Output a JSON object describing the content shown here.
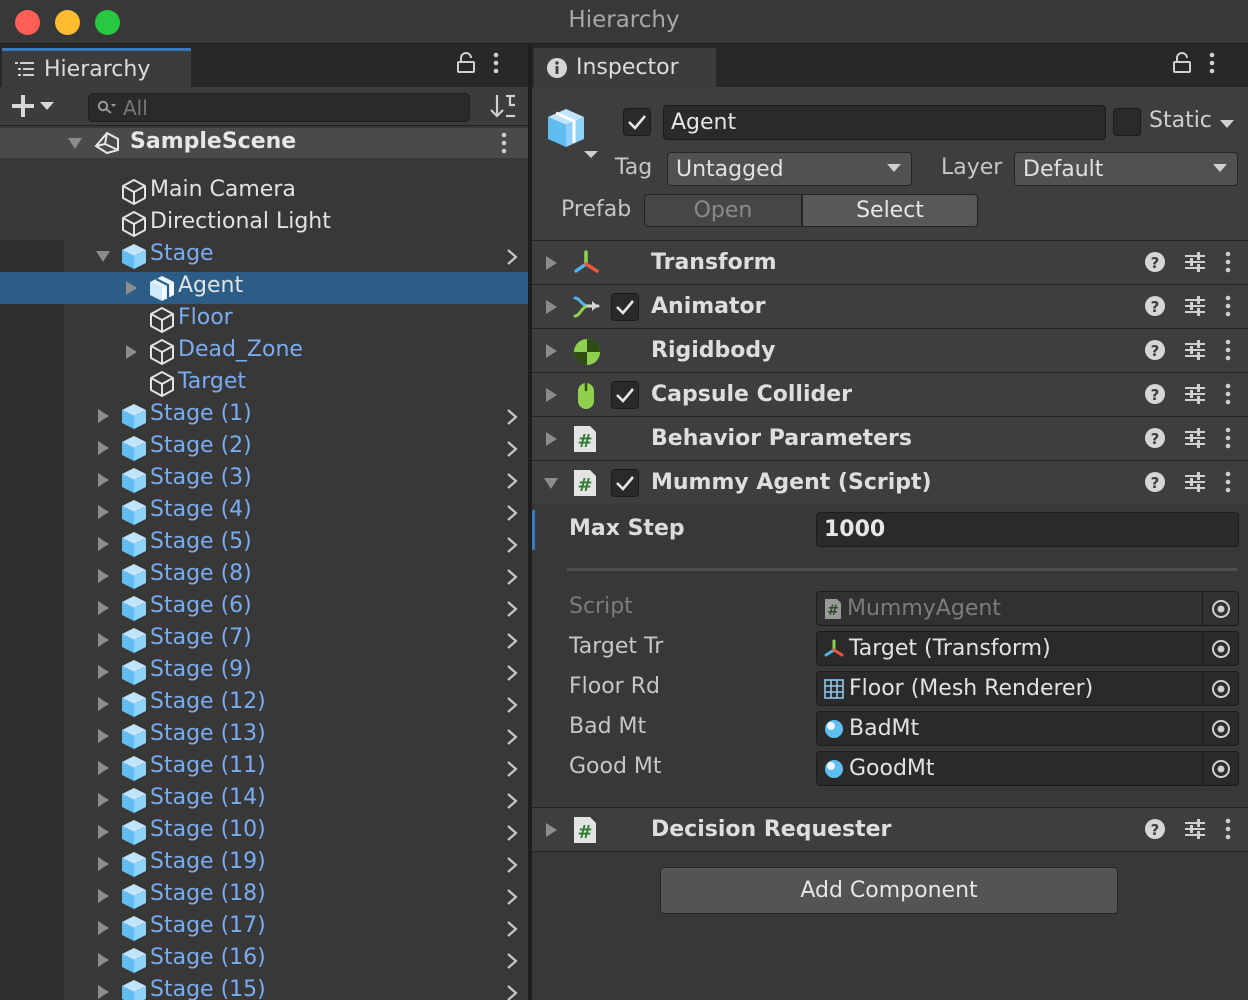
{
  "window": {
    "title": "Hierarchy",
    "colors": {
      "close": "#ff5f57",
      "minimize": "#febc2e",
      "maximize": "#28c840"
    }
  },
  "hierarchy": {
    "tab_label": "Hierarchy",
    "search_placeholder": "All",
    "scene": "SampleScene",
    "items": [
      {
        "label": "Main Camera",
        "icon": "gameobject-outline-icon",
        "prefab": false,
        "depth": 1,
        "expander": "none",
        "selected": false
      },
      {
        "label": "Directional Light",
        "icon": "gameobject-outline-icon",
        "prefab": false,
        "depth": 1,
        "expander": "none",
        "selected": false
      },
      {
        "label": "Stage",
        "icon": "prefab-cube-icon",
        "prefab": true,
        "depth": 1,
        "expander": "expanded",
        "chevron": true,
        "selected": false
      },
      {
        "label": "Agent",
        "icon": "prefab-variant-cube-icon",
        "prefab": true,
        "depth": 2,
        "expander": "collapsed",
        "selected": true
      },
      {
        "label": "Floor",
        "icon": "gameobject-outline-icon",
        "prefab": true,
        "depth": 2,
        "expander": "none",
        "selected": false
      },
      {
        "label": "Dead_Zone",
        "icon": "gameobject-outline-icon",
        "prefab": true,
        "depth": 2,
        "expander": "collapsed",
        "selected": false
      },
      {
        "label": "Target",
        "icon": "gameobject-outline-icon",
        "prefab": true,
        "depth": 2,
        "expander": "none",
        "selected": false
      },
      {
        "label": "Stage (1)",
        "icon": "prefab-cube-icon",
        "prefab": true,
        "depth": 1,
        "expander": "collapsed",
        "chevron": true,
        "selected": false
      },
      {
        "label": "Stage (2)",
        "icon": "prefab-cube-icon",
        "prefab": true,
        "depth": 1,
        "expander": "collapsed",
        "chevron": true,
        "selected": false
      },
      {
        "label": "Stage (3)",
        "icon": "prefab-cube-icon",
        "prefab": true,
        "depth": 1,
        "expander": "collapsed",
        "chevron": true,
        "selected": false
      },
      {
        "label": "Stage (4)",
        "icon": "prefab-cube-icon",
        "prefab": true,
        "depth": 1,
        "expander": "collapsed",
        "chevron": true,
        "selected": false
      },
      {
        "label": "Stage (5)",
        "icon": "prefab-cube-icon",
        "prefab": true,
        "depth": 1,
        "expander": "collapsed",
        "chevron": true,
        "selected": false
      },
      {
        "label": "Stage (8)",
        "icon": "prefab-cube-icon",
        "prefab": true,
        "depth": 1,
        "expander": "collapsed",
        "chevron": true,
        "selected": false
      },
      {
        "label": "Stage (6)",
        "icon": "prefab-cube-icon",
        "prefab": true,
        "depth": 1,
        "expander": "collapsed",
        "chevron": true,
        "selected": false
      },
      {
        "label": "Stage (7)",
        "icon": "prefab-cube-icon",
        "prefab": true,
        "depth": 1,
        "expander": "collapsed",
        "chevron": true,
        "selected": false
      },
      {
        "label": "Stage (9)",
        "icon": "prefab-cube-icon",
        "prefab": true,
        "depth": 1,
        "expander": "collapsed",
        "chevron": true,
        "selected": false
      },
      {
        "label": "Stage (12)",
        "icon": "prefab-cube-icon",
        "prefab": true,
        "depth": 1,
        "expander": "collapsed",
        "chevron": true,
        "selected": false
      },
      {
        "label": "Stage (13)",
        "icon": "prefab-cube-icon",
        "prefab": true,
        "depth": 1,
        "expander": "collapsed",
        "chevron": true,
        "selected": false
      },
      {
        "label": "Stage (11)",
        "icon": "prefab-cube-icon",
        "prefab": true,
        "depth": 1,
        "expander": "collapsed",
        "chevron": true,
        "selected": false
      },
      {
        "label": "Stage (14)",
        "icon": "prefab-cube-icon",
        "prefab": true,
        "depth": 1,
        "expander": "collapsed",
        "chevron": true,
        "selected": false
      },
      {
        "label": "Stage (10)",
        "icon": "prefab-cube-icon",
        "prefab": true,
        "depth": 1,
        "expander": "collapsed",
        "chevron": true,
        "selected": false
      },
      {
        "label": "Stage (19)",
        "icon": "prefab-cube-icon",
        "prefab": true,
        "depth": 1,
        "expander": "collapsed",
        "chevron": true,
        "selected": false
      },
      {
        "label": "Stage (18)",
        "icon": "prefab-cube-icon",
        "prefab": true,
        "depth": 1,
        "expander": "collapsed",
        "chevron": true,
        "selected": false
      },
      {
        "label": "Stage (17)",
        "icon": "prefab-cube-icon",
        "prefab": true,
        "depth": 1,
        "expander": "collapsed",
        "chevron": true,
        "selected": false
      },
      {
        "label": "Stage (16)",
        "icon": "prefab-cube-icon",
        "prefab": true,
        "depth": 1,
        "expander": "collapsed",
        "chevron": true,
        "selected": false
      },
      {
        "label": "Stage (15)",
        "icon": "prefab-cube-icon",
        "prefab": true,
        "depth": 1,
        "expander": "collapsed",
        "chevron": true,
        "selected": false
      }
    ],
    "colors": {
      "prefab_text": "#7aacf2",
      "selection": "#2c5d87"
    }
  },
  "inspector": {
    "tab_label": "Inspector",
    "object": {
      "name": "Agent",
      "active": true,
      "static_label": "Static",
      "static_checked": false,
      "tag_label": "Tag",
      "tag_value": "Untagged",
      "layer_label": "Layer",
      "layer_value": "Default",
      "prefab_label": "Prefab",
      "open_label": "Open",
      "select_label": "Select"
    },
    "components": [
      {
        "name": "Transform",
        "icon": "transform-icon",
        "has_toggle": false,
        "expanded": false
      },
      {
        "name": "Animator",
        "icon": "animator-icon",
        "has_toggle": true,
        "enabled": true,
        "expanded": false
      },
      {
        "name": "Rigidbody",
        "icon": "rigidbody-icon",
        "has_toggle": false,
        "expanded": false
      },
      {
        "name": "Capsule Collider",
        "icon": "capsule-collider-icon",
        "has_toggle": true,
        "enabled": true,
        "expanded": false
      },
      {
        "name": "Behavior Parameters",
        "icon": "script-icon",
        "has_toggle": false,
        "expanded": false
      },
      {
        "name": "Mummy Agent (Script)",
        "icon": "script-icon",
        "has_toggle": true,
        "enabled": true,
        "expanded": true
      }
    ],
    "mummy_agent": {
      "max_step_label": "Max Step",
      "max_step_value": "1000",
      "fields": [
        {
          "label": "Script",
          "value": "MummyAgent",
          "icon": "script-icon",
          "disabled": true
        },
        {
          "label": "Target Tr",
          "value": "Target (Transform)",
          "icon": "transform-icon",
          "disabled": false
        },
        {
          "label": "Floor Rd",
          "value": "Floor (Mesh Renderer)",
          "icon": "mesh-renderer-icon",
          "disabled": false
        },
        {
          "label": "Bad Mt",
          "value": "BadMt",
          "icon": "material-icon",
          "disabled": false
        },
        {
          "label": "Good Mt",
          "value": "GoodMt",
          "icon": "material-icon",
          "disabled": false
        }
      ]
    },
    "decision_requester": {
      "name": "Decision Requester",
      "icon": "script-icon"
    },
    "add_component_label": "Add Component"
  }
}
